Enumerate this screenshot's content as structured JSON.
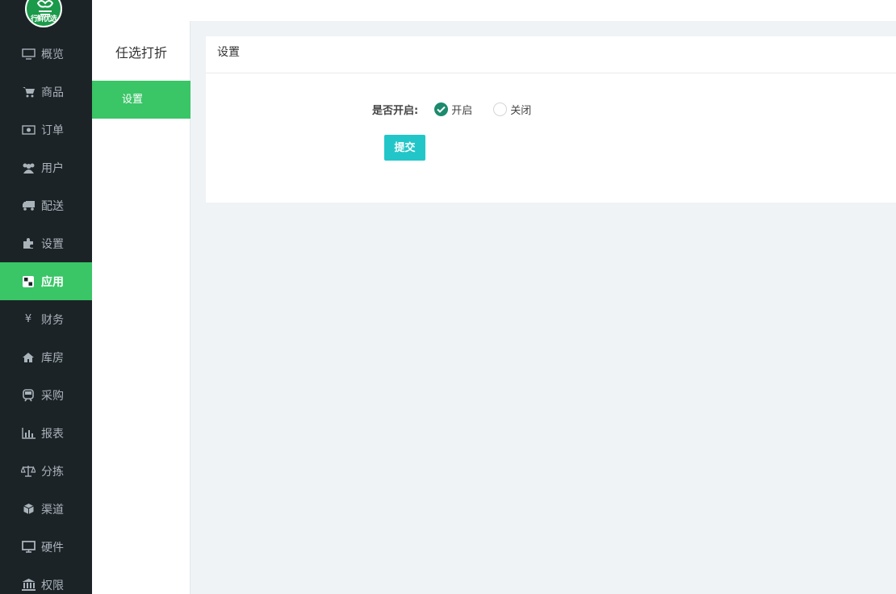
{
  "logo": {
    "text": "行鲜优选"
  },
  "sidebar": {
    "items": [
      {
        "label": "概览",
        "icon": "monitor-icon",
        "active": false
      },
      {
        "label": "商品",
        "icon": "cart-icon",
        "active": false
      },
      {
        "label": "订单",
        "icon": "money-icon",
        "active": false
      },
      {
        "label": "用户",
        "icon": "users-icon",
        "active": false
      },
      {
        "label": "配送",
        "icon": "truck-icon",
        "active": false
      },
      {
        "label": "设置",
        "icon": "puzzle-icon",
        "active": false
      },
      {
        "label": "应用",
        "icon": "grid-icon",
        "active": true
      },
      {
        "label": "财务",
        "icon": "yen-icon",
        "active": false
      },
      {
        "label": "库房",
        "icon": "home-icon",
        "active": false
      },
      {
        "label": "采购",
        "icon": "train-icon",
        "active": false
      },
      {
        "label": "报表",
        "icon": "bar-chart-icon",
        "active": false
      },
      {
        "label": "分拣",
        "icon": "balance-scale-icon",
        "active": false
      },
      {
        "label": "渠道",
        "icon": "cube-icon",
        "active": false
      },
      {
        "label": "硬件",
        "icon": "desktop-icon",
        "active": false
      },
      {
        "label": "权限",
        "icon": "bank-icon",
        "active": false
      }
    ]
  },
  "subsidebar": {
    "title": "任选打折",
    "items": [
      {
        "label": "设置",
        "active": true
      }
    ]
  },
  "panel": {
    "title": "设置",
    "form": {
      "label": "是否开启:",
      "options": [
        {
          "label": "开启",
          "checked": true
        },
        {
          "label": "关闭",
          "checked": false
        }
      ],
      "submit_label": "提交"
    }
  },
  "colors": {
    "sidebar_bg": "#1c2327",
    "accent_green": "#3ac567",
    "submit_btn": "#23c6c8",
    "radio_checked": "#1c8a6c",
    "page_bg": "#eff3f6"
  }
}
